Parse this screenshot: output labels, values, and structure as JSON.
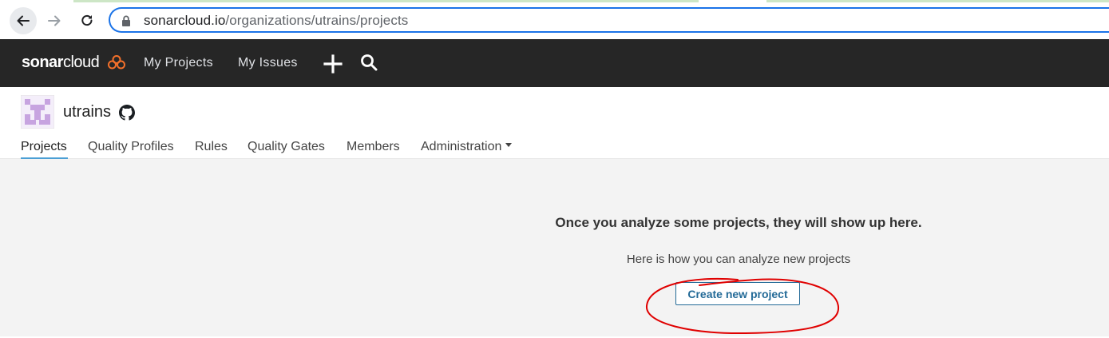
{
  "browser": {
    "url_host": "sonarcloud.io",
    "url_path": "/organizations/utrains/projects"
  },
  "topnav": {
    "logo_bold": "sonar",
    "logo_light": "cloud",
    "links": [
      "My Projects",
      "My Issues"
    ],
    "brand_color": "#f3702a"
  },
  "org": {
    "name": "utrains",
    "tabs": [
      "Projects",
      "Quality Profiles",
      "Rules",
      "Quality Gates",
      "Members",
      "Administration"
    ],
    "active_tab": "Projects"
  },
  "empty_state": {
    "title": "Once you analyze some projects, they will show up here.",
    "subtitle": "Here is how you can analyze new projects",
    "button_label": "Create new project"
  },
  "colors": {
    "navbar": "#262626",
    "active_tab_underline": "#4b9fd5",
    "button_border": "#236a97",
    "annotation": "#e00000"
  }
}
